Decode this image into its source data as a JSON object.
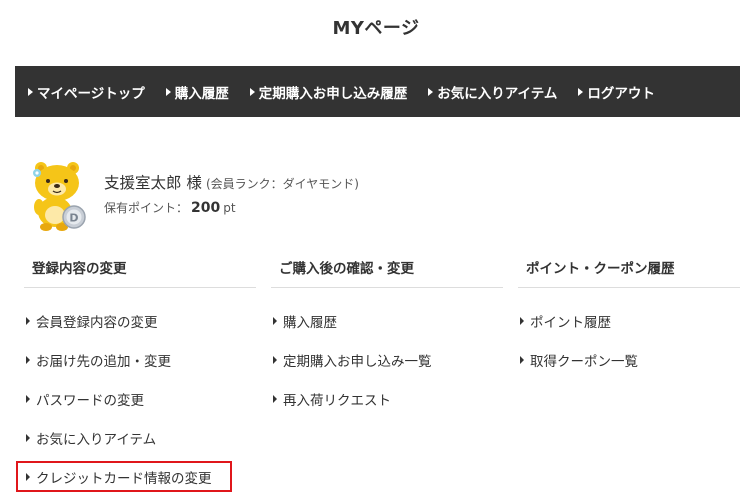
{
  "page": {
    "title": "MYページ"
  },
  "nav": {
    "items": [
      {
        "label": "マイページトップ"
      },
      {
        "label": "購入履歴"
      },
      {
        "label": "定期購入お申し込み履歴"
      },
      {
        "label": "お気に入りアイテム"
      },
      {
        "label": "ログアウト"
      }
    ]
  },
  "profile": {
    "name": "支援室太郎 様",
    "rank": "(会員ランク：ダイヤモンド)",
    "points_label": "保有ポイント：",
    "points_value": "200",
    "points_unit": "pt",
    "badge_letter": "D"
  },
  "columns": [
    {
      "heading": "登録内容の変更",
      "items": [
        {
          "label": "会員登録内容の変更"
        },
        {
          "label": "お届け先の追加・変更"
        },
        {
          "label": "パスワードの変更"
        },
        {
          "label": "お気に入りアイテム"
        },
        {
          "label": "クレジットカード情報の変更"
        }
      ]
    },
    {
      "heading": "ご購入後の確認・変更",
      "items": [
        {
          "label": "購入履歴"
        },
        {
          "label": "定期購入お申し込み一覧"
        },
        {
          "label": "再入荷リクエスト"
        }
      ]
    },
    {
      "heading": "ポイント・クーポン履歴",
      "items": [
        {
          "label": "ポイント履歴"
        },
        {
          "label": "取得クーポン一覧"
        }
      ]
    }
  ],
  "colors": {
    "nav_bg": "#333333",
    "highlight_border": "#e0161b",
    "bear_yellow": "#f5c518",
    "badge_gray": "#c8ced6"
  }
}
